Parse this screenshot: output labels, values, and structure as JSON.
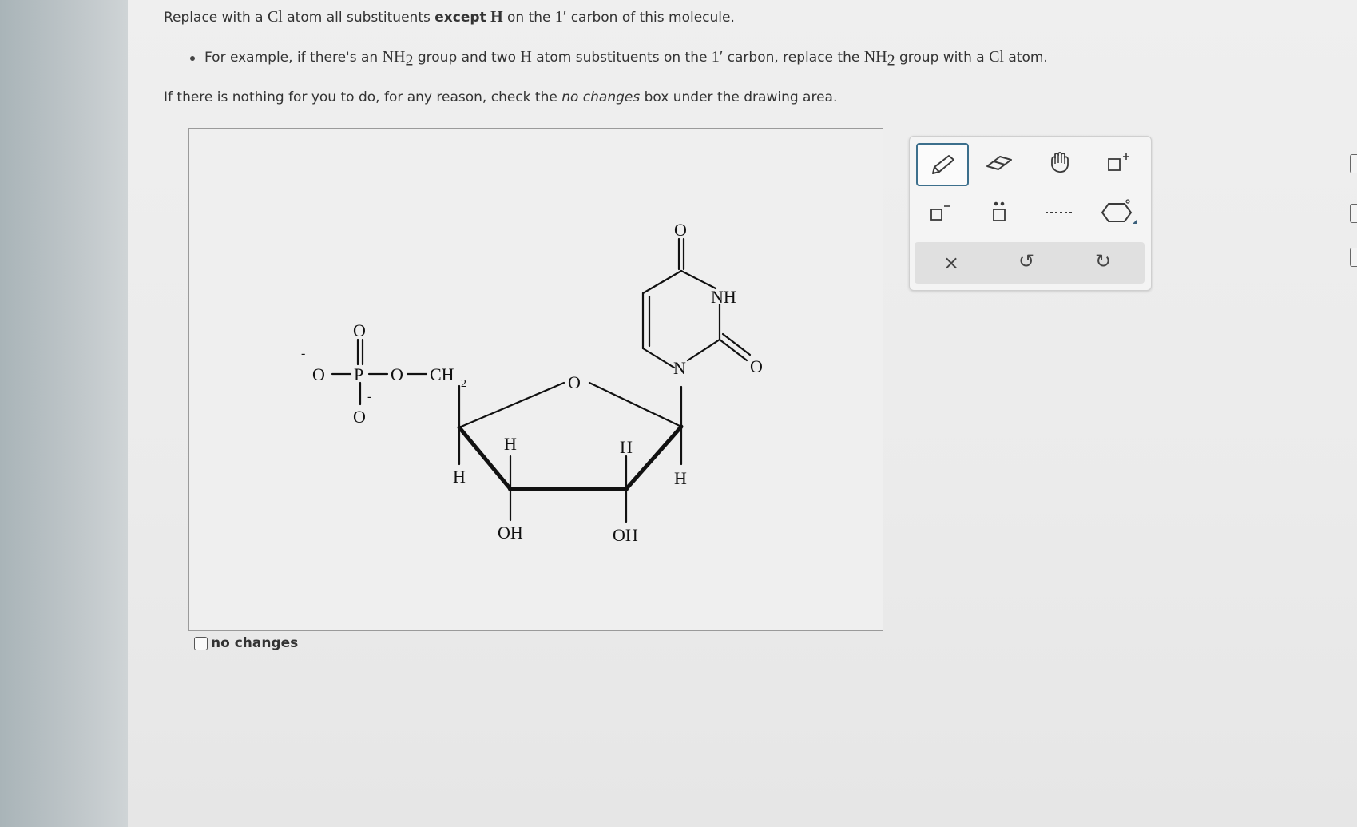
{
  "instructions": {
    "line1_a": "Replace with a ",
    "line1_cl": "Cl",
    "line1_b": " atom all substituents ",
    "line1_except": "except",
    "line1_h": "H",
    "line1_c": " on the ",
    "line1_one": "1",
    "line1_prime": "′",
    "line1_d": " carbon of this molecule.",
    "line2_a": "For example, if there's an ",
    "line2_nh": "NH",
    "line2_sub": "2",
    "line2_b": " group and two ",
    "line2_h": "H",
    "line2_c": " atom substituents on the ",
    "line2_one": "1",
    "line2_prime": "′",
    "line2_d": " carbon, replace the ",
    "line2_nh2": "NH",
    "line2_sub2": "2",
    "line2_e": " group with a ",
    "line2_cl": "Cl",
    "line2_f": " atom.",
    "line3_a": "If there is nothing for you to do, for any reason, check the ",
    "line3_italic": "no changes",
    "line3_b": " box under the drawing area."
  },
  "molecule": {
    "labels": {
      "o_minus_left": "O",
      "minus_left": "-",
      "p": "P",
      "o_top": "O",
      "o_bottom": "O",
      "minus_bottom": "-",
      "o_bridge": "O",
      "ch": "CH",
      "ch_sub": "2",
      "ring_o": "O",
      "h_c4": "H",
      "h_c3": "H",
      "oh_c3": "OH",
      "h_c2": "H",
      "oh_c2": "OH",
      "h_c1": "H",
      "n1": "N",
      "nh": "NH",
      "o_c2": "O",
      "o_c4": "O"
    }
  },
  "checkbox": {
    "label": "no changes",
    "checked": false
  },
  "toolbar": {
    "tools": [
      "pencil-icon",
      "eraser-icon",
      "hand-icon",
      "charge-plus-icon",
      "charge-minus-icon",
      "lone-pair-icon",
      "dotted-bond-icon",
      "ring-icon"
    ],
    "actions": {
      "clear": "×",
      "undo": "↺",
      "redo": "↻"
    },
    "accent": "#3c6f8c"
  }
}
